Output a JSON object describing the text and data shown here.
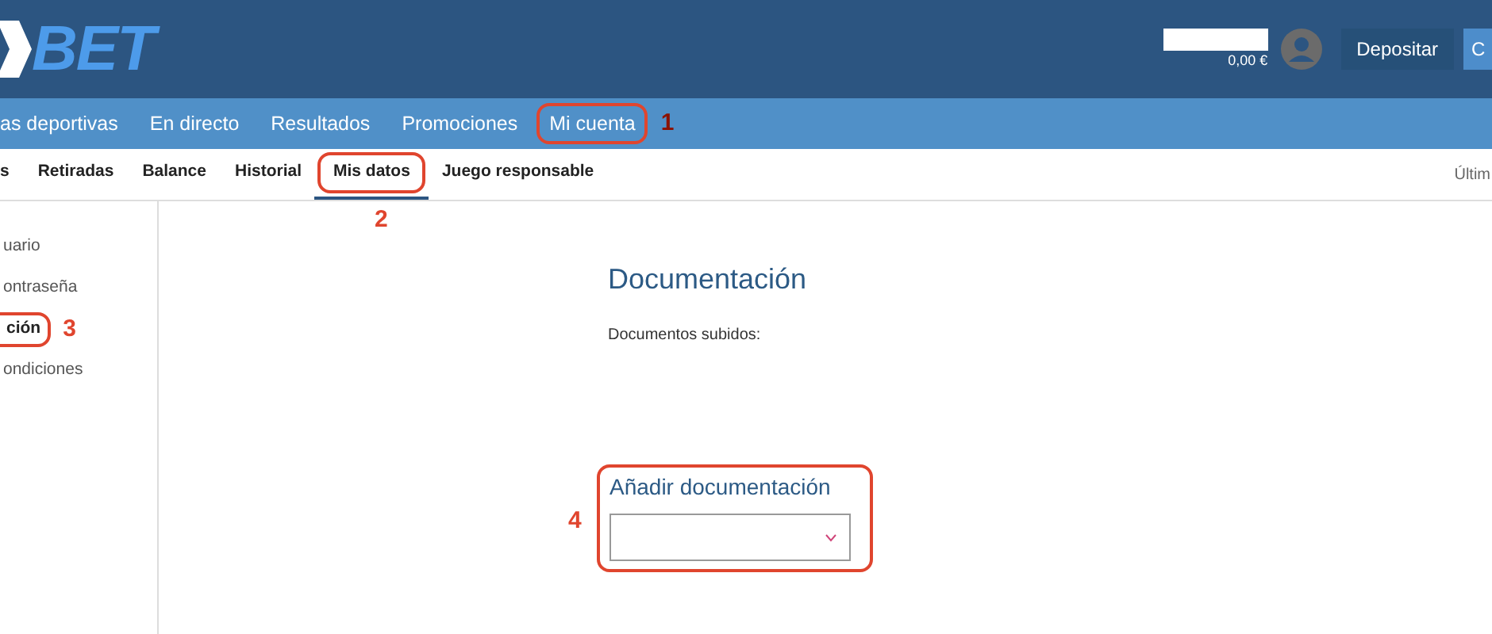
{
  "header": {
    "logo": "BET",
    "balance": "0,00 €",
    "deposit_button": "Depositar",
    "cut_button": "C"
  },
  "nav": [
    {
      "label": "as deportivas"
    },
    {
      "label": "En directo"
    },
    {
      "label": "Resultados"
    },
    {
      "label": "Promociones"
    },
    {
      "label": "Mi cuenta",
      "callout": "1"
    }
  ],
  "subnav": {
    "tabs": [
      {
        "label": "s",
        "selected": false
      },
      {
        "label": "Retiradas",
        "selected": false
      },
      {
        "label": "Balance",
        "selected": false
      },
      {
        "label": "Historial",
        "selected": false
      },
      {
        "label": "Mis datos",
        "selected": true,
        "callout": "2"
      },
      {
        "label": "Juego responsable",
        "selected": false
      }
    ],
    "right_text": "Últim"
  },
  "sidebar": {
    "items": [
      {
        "label": "uario",
        "selected": false
      },
      {
        "label": "ontraseña",
        "selected": false
      },
      {
        "label": "ción",
        "selected": true,
        "callout": "3"
      },
      {
        "label": "ondiciones",
        "selected": false
      }
    ]
  },
  "main": {
    "title": "Documentación",
    "uploaded_label": "Documentos subidos:",
    "add_section": {
      "title": "Añadir documentación",
      "callout": "4"
    }
  }
}
